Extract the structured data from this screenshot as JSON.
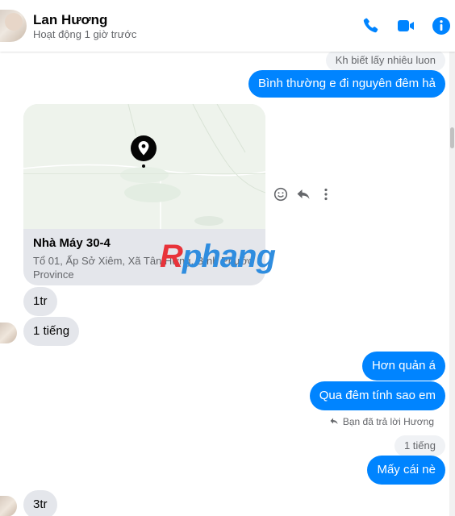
{
  "header": {
    "name": "Lan Hương",
    "status": "Hoạt động 1 giờ trước",
    "icons": [
      "phone-icon",
      "video-icon",
      "info-icon"
    ],
    "accent": "#0084ff"
  },
  "messages": {
    "reply_quote_top": "Kh biết lấy nhiêu luon",
    "out_1": "Bình thường e đi nguyên đêm hả",
    "location": {
      "place": "Nhà Máy 30-4",
      "address": "Tổ 01, Ấp Sở Xiêm, Xã Tân Hưng, Bình Phước Province"
    },
    "in_1": "1tr",
    "in_2": "1 tiếng",
    "out_2": "Hơn quản á",
    "out_3": "Qua đêm tính sao em",
    "reply_note": "Bạn đã trả lời Hương",
    "reply_quote_2": "1 tiếng",
    "out_4": "Mấy cái nè",
    "in_3": "3tr"
  },
  "watermark": {
    "part1": "R",
    "part2": "phang"
  },
  "colors": {
    "outgoing_bubble": "#0084ff",
    "incoming_bubble": "#e4e6eb",
    "watermark_red": "#e8333a",
    "watermark_blue": "#2f8ddf"
  }
}
